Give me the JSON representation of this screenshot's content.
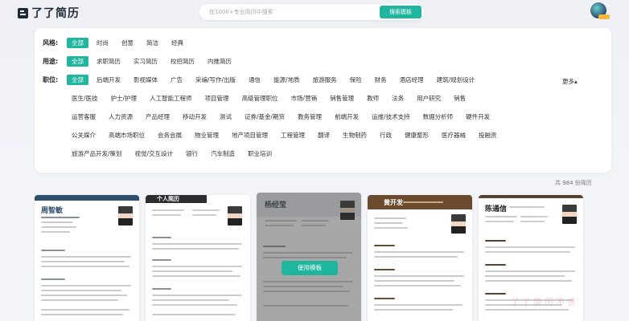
{
  "header": {
    "logo_text": "了了简历",
    "search_placeholder": "在1000+专业简历中搜索",
    "search_button": "搜索模板"
  },
  "filters": {
    "style": {
      "label": "风格:",
      "options": [
        "全部",
        "时尚",
        "创意",
        "简洁",
        "经典"
      ],
      "active": "全部"
    },
    "purpose": {
      "label": "用途:",
      "options": [
        "全部",
        "求职简历",
        "实习简历",
        "校招简历",
        "内推简历"
      ],
      "active": "全部"
    },
    "position": {
      "label": "职位:",
      "more": "更多",
      "rows": [
        [
          "全部",
          "后端开发",
          "影视媒体",
          "广告",
          "采编/写作/出版",
          "通信",
          "能源/地质",
          "旅游服务",
          "保险",
          "财务",
          "酒店经理",
          "建筑/规划设计"
        ],
        [
          "医生/医技",
          "护士/护理",
          "人工智能工程师",
          "项目管理",
          "高级管理职位",
          "市场/营销",
          "销售管理",
          "教师",
          "法务",
          "用户研究",
          "销售"
        ],
        [
          "运营客服",
          "人力资源",
          "产品经理",
          "移动开发",
          "测试",
          "证券/基金/期货",
          "教务管理",
          "前端开发",
          "运维/技术支持",
          "数据分析师",
          "硬件开发"
        ],
        [
          "公关媒介",
          "高端市场职位",
          "会务会展",
          "物业管理",
          "地产项目管理",
          "工程管理",
          "翻译",
          "生物制药",
          "行政",
          "健康整形",
          "医疗器械",
          "投融资"
        ],
        [
          "旅游产品开发/策划",
          "视觉/交互设计",
          "银行",
          "汽车制造",
          "职业培训"
        ]
      ],
      "active": "全部"
    }
  },
  "result_count": "共 984 份简历",
  "templates": [
    {
      "name": "周智敏",
      "accent": "#2f4f6f"
    },
    {
      "name": "个人简历",
      "accent": "#2d2d2d"
    },
    {
      "name": "杨经莹",
      "accent": "#3d4a57",
      "hover_button": "使用模板"
    },
    {
      "name": "黄开发",
      "accent": "#6b4a2e"
    },
    {
      "name": "陈通信",
      "accent": "#5a4030"
    }
  ],
  "watermark": "了了简历不该"
}
